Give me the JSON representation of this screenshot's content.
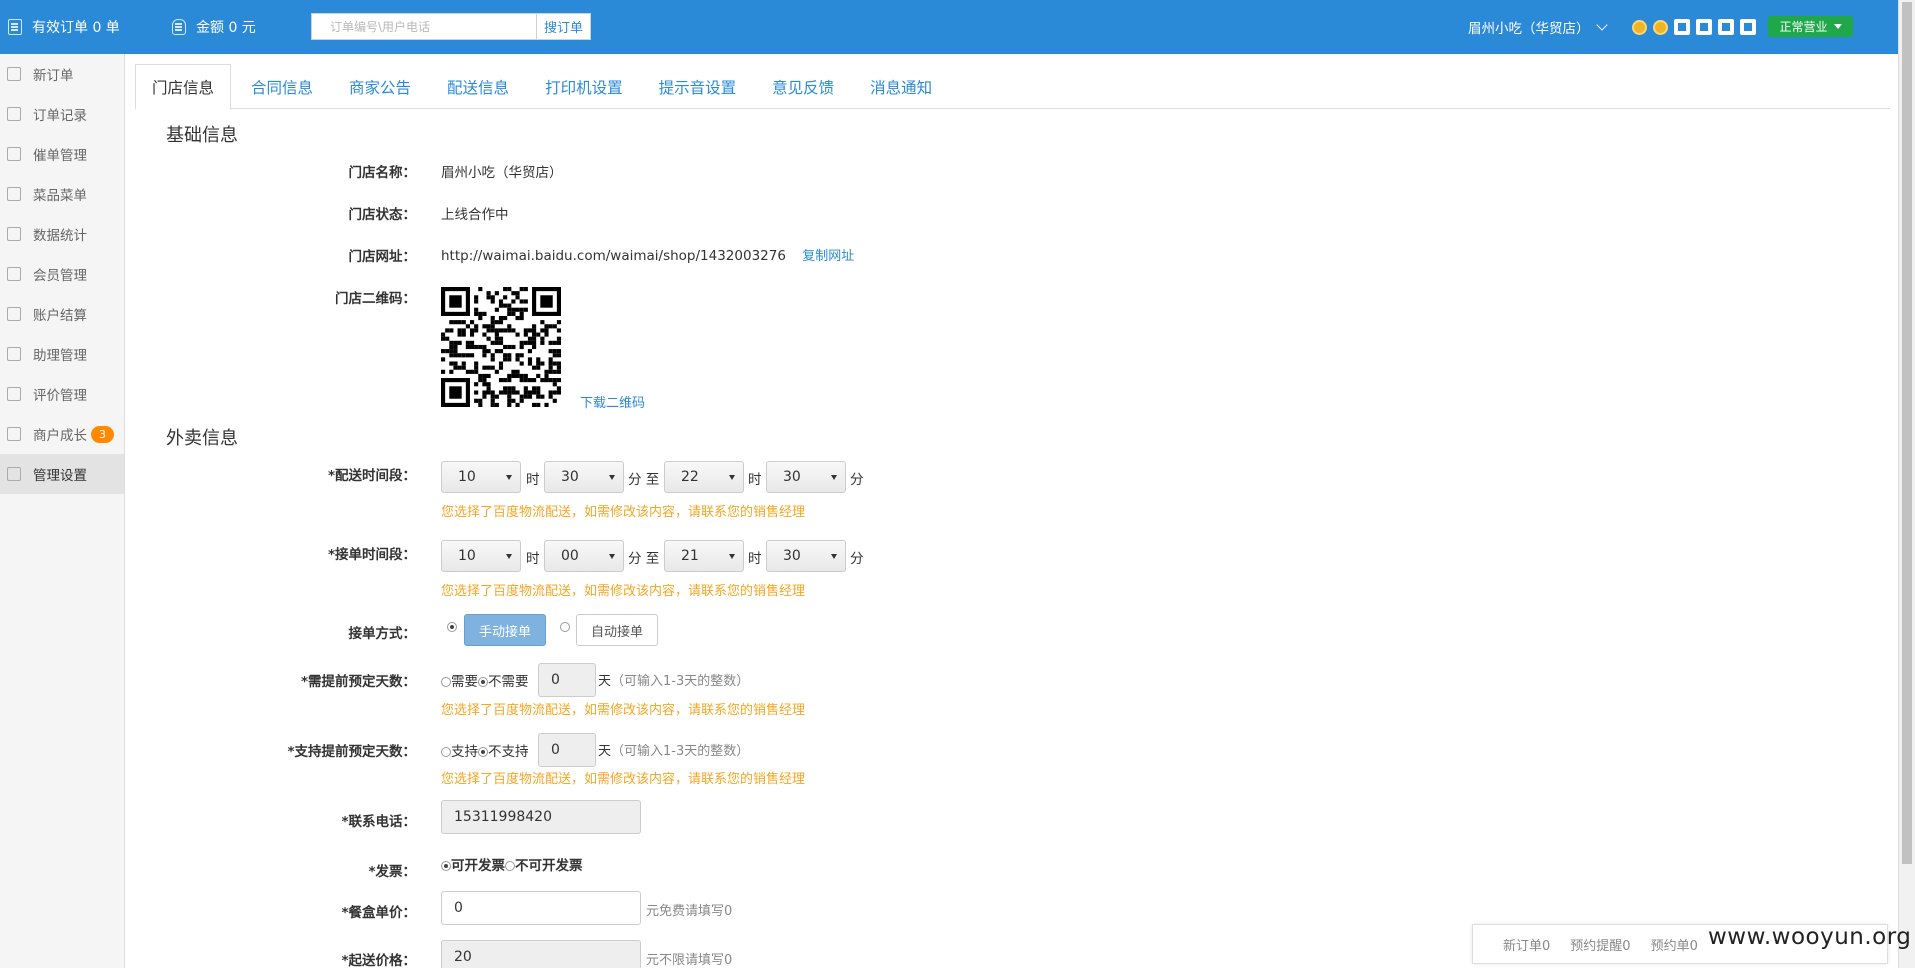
{
  "topbar": {
    "orders_label": "有效订单 0 单",
    "amount_label": "金额 0 元",
    "search_placeholder": "订单编号\\用户电话",
    "search_button": "搜订单",
    "store_name": "眉州小吃（华贸店）",
    "status_button": "正常营业",
    "bg_color": "#2b8ad8",
    "status_color": "#1fa84a"
  },
  "sidebar": {
    "items": [
      {
        "label": "新订单",
        "icon": "new-order-icon"
      },
      {
        "label": "订单记录",
        "icon": "order-record-icon"
      },
      {
        "label": "催单管理",
        "icon": "reminder-icon"
      },
      {
        "label": "菜品菜单",
        "icon": "menu-list-icon"
      },
      {
        "label": "数据统计",
        "icon": "chart-icon"
      },
      {
        "label": "会员管理",
        "icon": "member-icon"
      },
      {
        "label": "账户结算",
        "icon": "account-icon"
      },
      {
        "label": "助理管理",
        "icon": "assistant-icon"
      },
      {
        "label": "评价管理",
        "icon": "review-icon"
      },
      {
        "label": "商户成长",
        "icon": "growth-icon",
        "badge": "3"
      },
      {
        "label": "管理设置",
        "icon": "settings-icon"
      }
    ]
  },
  "tabs": [
    "门店信息",
    "合同信息",
    "商家公告",
    "配送信息",
    "打印机设置",
    "提示音设置",
    "意见反馈",
    "消息通知"
  ],
  "basic": {
    "title": "基础信息",
    "name_label": "门店名称：",
    "name_value": "眉州小吃（华贸店）",
    "status_label": "门店状态：",
    "status_value": "上线合作中",
    "url_label": "门店网址：",
    "url_value": "http://waimai.baidu.com/waimai/shop/1432003276",
    "copy_link": "复制网址",
    "qr_label": "门店二维码：",
    "qr_download": "下载二维码"
  },
  "delivery": {
    "title": "外卖信息",
    "delivery_time_label": "*配送时间段：",
    "delivery_time": {
      "start_h": "10",
      "start_m": "30",
      "end_h": "22",
      "end_m": "30"
    },
    "order_time_label": "*接单时间段：",
    "order_time": {
      "start_h": "10",
      "start_m": "00",
      "end_h": "21",
      "end_m": "30"
    },
    "hour_unit": "时",
    "minute_unit": "分",
    "to_text": "至",
    "warning": "您选择了百度物流配送，如需修改该内容，请联系您的销售经理",
    "accept_label": "接单方式：",
    "accept_manual": "手动接单",
    "accept_auto": "自动接单",
    "advance_label": "*需提前预定天数：",
    "need": "需要",
    "not_need": "不需要",
    "advance_days": "0",
    "day_unit": "天",
    "day_hint": "（可输入1-3天的整数）",
    "support_label": "*支持提前预定天数：",
    "support": "支持",
    "not_support": "不支持",
    "support_days": "0",
    "phone_label": "*联系电话：",
    "phone": "15311998420",
    "invoice_label": "*发票：",
    "invoice_yes": "可开发票",
    "invoice_no": "不可开发票",
    "box_price_label": "*餐盒单价：",
    "box_price": "0",
    "box_hint": "元免费请填写0",
    "min_price_label": "*起送价格：",
    "min_price": "20",
    "min_hint": "元不限请填写0"
  },
  "bottom": {
    "new_orders": "新订单0",
    "reserve_remind": "预约提醒0",
    "reserve_orders": "预约单0"
  },
  "watermark": "www.wooyun.org"
}
